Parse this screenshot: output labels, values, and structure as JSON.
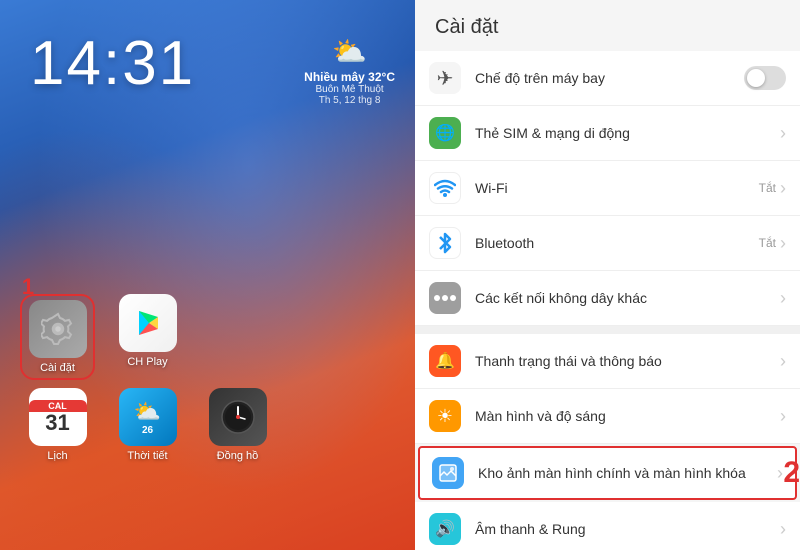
{
  "left": {
    "time": "14:31",
    "weather": {
      "icon": "⛅",
      "temp": "Nhiều mây 32°C",
      "desc": "Buôn Mê Thuột",
      "date": "Th 5, 12 thg 8"
    },
    "step1_label": "1",
    "apps_row1": [
      {
        "label": "Cài đặt",
        "icon_type": "settings",
        "highlighted": true
      },
      {
        "label": "CH Play",
        "icon_type": "chplay",
        "highlighted": false
      }
    ],
    "apps_row2": [
      {
        "label": "Lịch",
        "icon_type": "calendar",
        "highlighted": false
      },
      {
        "label": "Thời tiết",
        "icon_type": "weather",
        "highlighted": false
      },
      {
        "label": "Đồng hồ",
        "icon_type": "clock",
        "highlighted": false
      }
    ]
  },
  "right": {
    "title": "Cài đặt",
    "step2_label": "2",
    "items": [
      {
        "id": "airplane",
        "icon_type": "airplane",
        "icon_unicode": "✈",
        "label": "Chế độ trên máy bay",
        "right_type": "toggle",
        "right_text": "",
        "highlighted": false
      },
      {
        "id": "sim",
        "icon_type": "sim",
        "icon_unicode": "🌐",
        "label": "Thẻ SIM & mạng di động",
        "right_type": "chevron",
        "right_text": "",
        "highlighted": false
      },
      {
        "id": "wifi",
        "icon_type": "wifi",
        "icon_unicode": "📶",
        "label": "Wi-Fi",
        "right_type": "text-chevron",
        "right_text": "Tắt",
        "highlighted": false
      },
      {
        "id": "bluetooth",
        "icon_type": "bluetooth",
        "icon_unicode": "❄",
        "label": "Bluetooth",
        "right_type": "text-chevron",
        "right_text": "Tắt",
        "highlighted": false
      },
      {
        "id": "network",
        "icon_type": "network",
        "icon_unicode": "⋯",
        "label": "Các kết nối không dây khác",
        "right_type": "chevron",
        "right_text": "",
        "highlighted": false
      },
      {
        "id": "divider1",
        "type": "divider"
      },
      {
        "id": "notification",
        "icon_type": "notification",
        "icon_unicode": "🔔",
        "label": "Thanh trạng thái và thông báo",
        "right_type": "chevron",
        "right_text": "",
        "highlighted": false
      },
      {
        "id": "brightness",
        "icon_type": "brightness",
        "icon_unicode": "☀",
        "label": "Màn hình và độ sáng",
        "right_type": "chevron",
        "right_text": "",
        "highlighted": false
      },
      {
        "id": "wallpaper",
        "icon_type": "wallpaper",
        "icon_unicode": "🖼",
        "label": "Kho ảnh màn hình chính và màn hình khóa",
        "right_type": "chevron",
        "right_text": "",
        "highlighted": true
      },
      {
        "id": "sound",
        "icon_type": "sound",
        "icon_unicode": "🔊",
        "label": "Âm thanh & Rung",
        "right_type": "chevron",
        "right_text": "",
        "highlighted": false
      }
    ]
  }
}
